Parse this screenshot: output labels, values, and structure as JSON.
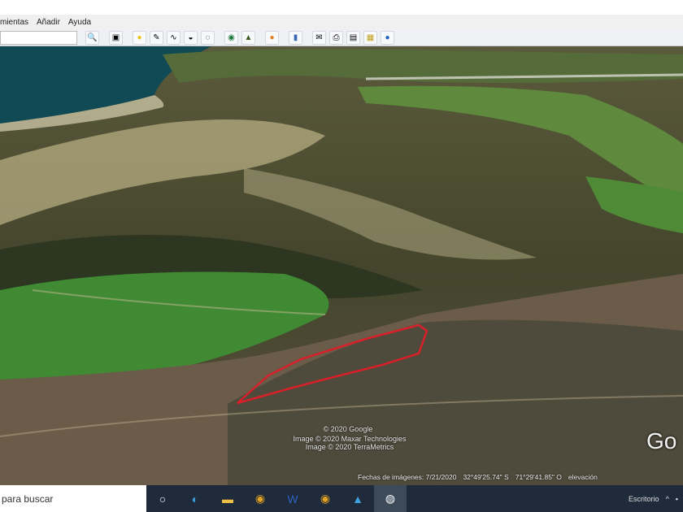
{
  "menu": [
    "mientas",
    "Añadir",
    "Ayuda"
  ],
  "map": {
    "attribution": [
      "© 2020 Google",
      "Image © 2020 Maxar Technologies",
      "Image © 2020 TerraMetrics"
    ],
    "image_date": "Fechas de imágenes: 7/21/2020",
    "lat": "32°49'25.74\" S",
    "lon": "71°29'41.85\" O",
    "elevation_label": "elevación",
    "logo": "Go",
    "boundary_color": "#d8202a"
  },
  "taskbar": {
    "search_placeholder": "para buscar",
    "desktop_label": "Escritorio"
  }
}
